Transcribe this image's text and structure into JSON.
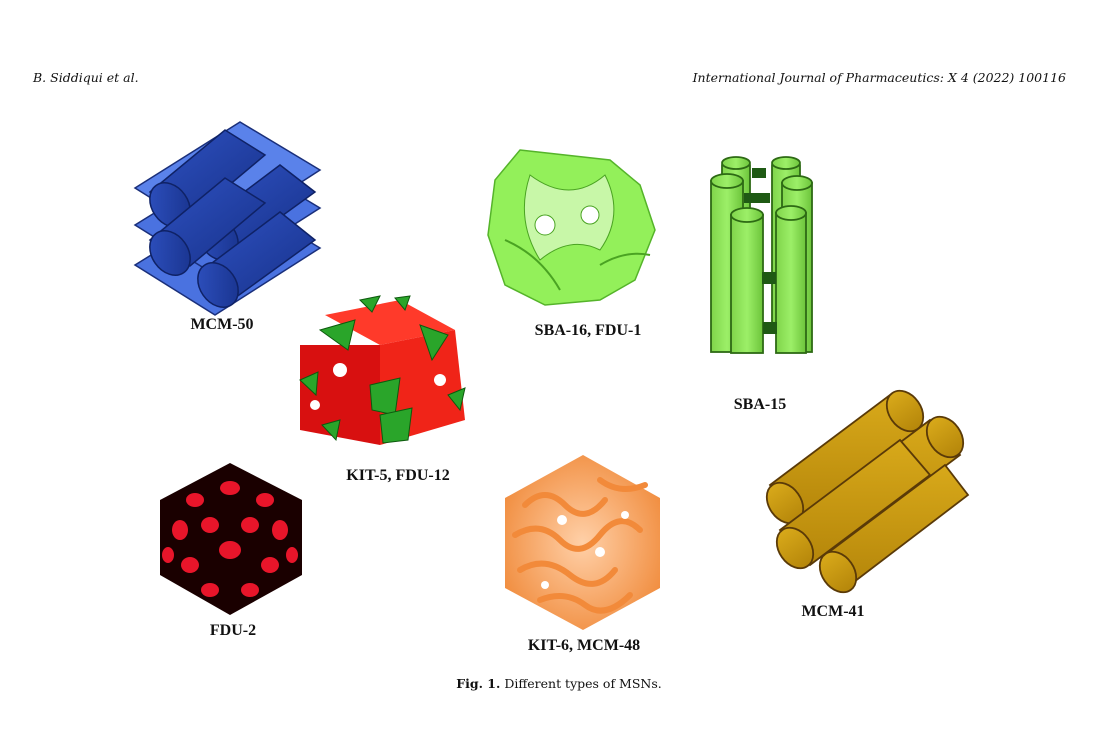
{
  "header": {
    "left": "B. Siddiqui et al.",
    "right": "International Journal of Pharmaceutics: X 4 (2022) 100116"
  },
  "labels": {
    "mcm50": "MCM-50",
    "kit5": "KIT-5, FDU-12",
    "sba16": "SBA-16, FDU-1",
    "sba15": "SBA-15",
    "fdu2": "FDU-2",
    "kit6": "KIT-6, MCM-48",
    "mcm41": "MCM-41"
  },
  "caption": {
    "prefix": "Fig. 1.",
    "text": "Different types of MSNs."
  },
  "colors": {
    "mcm50": "#1f3fa8",
    "kit5_red": "#e01010",
    "kit5_green": "#2aa52a",
    "sba16": "#7be83a",
    "sba15": "#8fe05a",
    "fdu2": "#e8152a",
    "kit6": "#f0873a",
    "mcm41": "#c99a10"
  }
}
